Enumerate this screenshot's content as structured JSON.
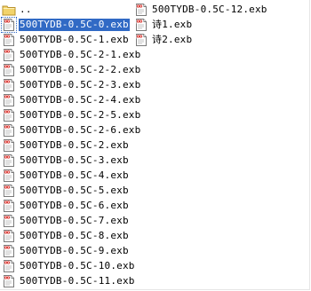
{
  "window": {
    "view": "list"
  },
  "selected_index": 1,
  "column1": [
    {
      "label": "..",
      "kind": "folder-up"
    },
    {
      "label": "500TYDB-0.5C-0.exb",
      "kind": "exb"
    },
    {
      "label": "500TYDB-0.5C-1.exb",
      "kind": "exb"
    },
    {
      "label": "500TYDB-0.5C-2-1.exb",
      "kind": "exb"
    },
    {
      "label": "500TYDB-0.5C-2-2.exb",
      "kind": "exb"
    },
    {
      "label": "500TYDB-0.5C-2-3.exb",
      "kind": "exb"
    },
    {
      "label": "500TYDB-0.5C-2-4.exb",
      "kind": "exb"
    },
    {
      "label": "500TYDB-0.5C-2-5.exb",
      "kind": "exb"
    },
    {
      "label": "500TYDB-0.5C-2-6.exb",
      "kind": "exb"
    },
    {
      "label": "500TYDB-0.5C-2.exb",
      "kind": "exb"
    },
    {
      "label": "500TYDB-0.5C-3.exb",
      "kind": "exb"
    },
    {
      "label": "500TYDB-0.5C-4.exb",
      "kind": "exb"
    },
    {
      "label": "500TYDB-0.5C-5.exb",
      "kind": "exb"
    },
    {
      "label": "500TYDB-0.5C-6.exb",
      "kind": "exb"
    },
    {
      "label": "500TYDB-0.5C-7.exb",
      "kind": "exb"
    },
    {
      "label": "500TYDB-0.5C-8.exb",
      "kind": "exb"
    },
    {
      "label": "500TYDB-0.5C-9.exb",
      "kind": "exb"
    },
    {
      "label": "500TYDB-0.5C-10.exb",
      "kind": "exb"
    },
    {
      "label": "500TYDB-0.5C-11.exb",
      "kind": "exb"
    }
  ],
  "column2": [
    {
      "label": "500TYDB-0.5C-12.exb",
      "kind": "exb"
    },
    {
      "label": "诗1.exb",
      "kind": "exb"
    },
    {
      "label": "诗2.exb",
      "kind": "exb"
    }
  ],
  "colors": {
    "selection": "#316ac5",
    "folder": "#f2d36b",
    "doc_accent": "#d9302a"
  }
}
